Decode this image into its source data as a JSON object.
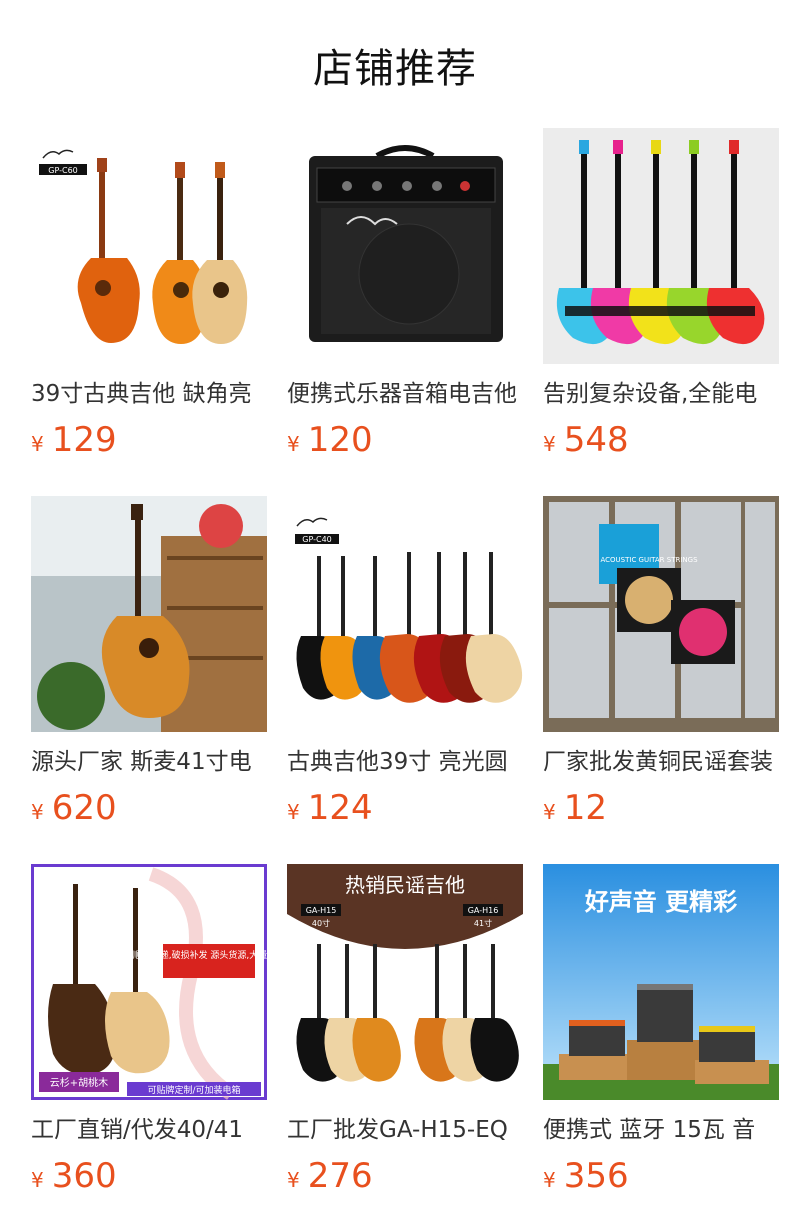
{
  "page_title": "店铺推荐",
  "currency_symbol": "¥",
  "products": [
    {
      "name": "39寸古典吉他 缺角亮",
      "price": "129",
      "image_badge": "GP-C60"
    },
    {
      "name": "便携式乐器音箱电吉他",
      "price": "120"
    },
    {
      "name": "告别复杂设备,全能电",
      "price": "548"
    },
    {
      "name": "源头厂家 斯麦41寸电",
      "price": "620"
    },
    {
      "name": "古典吉他39寸 亮光圆",
      "price": "124",
      "image_badge": "GP-C40"
    },
    {
      "name": "厂家批发黄铜民谣套装",
      "price": "12",
      "image_badge": "ACOUSTIC GUITAR STRINGS"
    },
    {
      "name": "工厂直销/代发40/41",
      "price": "360",
      "image_badge": "云杉+胡桃木",
      "image_note": "顺丰快递,破损补发 源头货源,大量现货",
      "image_footer": "可贴牌定制/可加装电箱"
    },
    {
      "name": "工厂批发GA-H15-EQ",
      "price": "276",
      "image_headline": "热销民谣吉他",
      "image_badges": [
        "GA-H15",
        "GA-H16"
      ],
      "image_sizes": [
        "40寸",
        "41寸"
      ]
    },
    {
      "name": "便携式 蓝牙 15瓦 音",
      "price": "356",
      "image_headline": "好声音 更精彩"
    }
  ],
  "colors": {
    "price": "#e8501e",
    "text": "#333333",
    "title": "#111111"
  }
}
